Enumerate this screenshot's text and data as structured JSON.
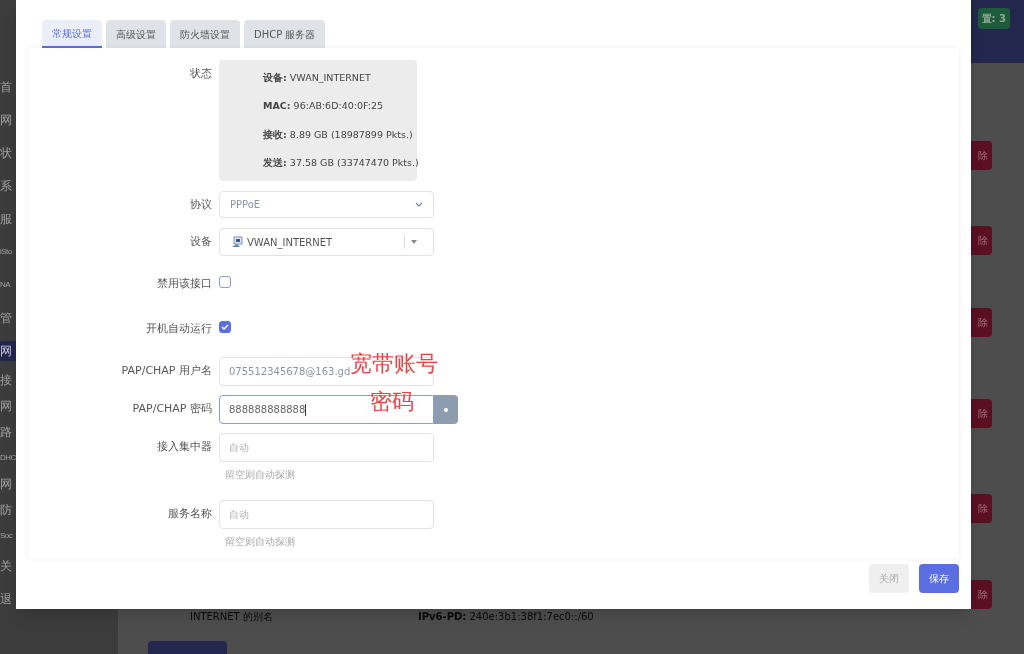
{
  "background": {
    "sidebar": [
      {
        "label": "首",
        "kind": "main",
        "selected": false
      },
      {
        "label": "网",
        "kind": "main",
        "selected": false
      },
      {
        "label": "状",
        "kind": "main",
        "selected": false
      },
      {
        "label": "系",
        "kind": "main",
        "selected": false
      },
      {
        "label": "服",
        "kind": "main",
        "selected": false
      },
      {
        "label": "iSto",
        "kind": "main",
        "selected": false
      },
      {
        "label": "NA",
        "kind": "main",
        "selected": false
      },
      {
        "label": "管",
        "kind": "main",
        "selected": false
      },
      {
        "label": "网",
        "kind": "main",
        "selected": true
      },
      {
        "label": "接",
        "kind": "sub",
        "selected": false
      },
      {
        "label": "网",
        "kind": "sub",
        "selected": false
      },
      {
        "label": "路",
        "kind": "sub",
        "selected": false
      },
      {
        "label": "DHC",
        "kind": "sub",
        "selected": false
      },
      {
        "label": "网",
        "kind": "sub",
        "selected": false
      },
      {
        "label": "防",
        "kind": "sub",
        "selected": false
      },
      {
        "label": "Soc",
        "kind": "sub",
        "selected": false
      },
      {
        "label": "关",
        "kind": "main",
        "selected": false
      },
      {
        "label": "退",
        "kind": "main",
        "selected": false
      }
    ],
    "badge": "置: 3",
    "delete_buttons": [
      "除",
      "除",
      "除",
      "除",
      "除",
      "除"
    ],
    "alias": "INTERNET 的别名",
    "ipv6": "**IPv6-PD:** 240e:3b1:38f1:7ec0::/60"
  },
  "dialog": {
    "tabs": [
      {
        "label": "常规设置",
        "selected": true
      },
      {
        "label": "高级设置",
        "selected": false
      },
      {
        "label": "防火墙设置",
        "selected": false
      },
      {
        "label": "DHCP 服务器",
        "selected": false
      }
    ],
    "status": {
      "label": "状态",
      "lines": [
        "**设备:** VWAN_INTERNET",
        "**MAC:** 96:AB:6D:40:0F:25",
        "**接收:** 8.89 GB (18987899 Pkts.)",
        "**发送:** 37.58 GB (33747470 Pkts.)"
      ]
    },
    "fields": [
      {
        "kind": "select",
        "label": "协议",
        "value": "PPPoE"
      },
      {
        "kind": "device",
        "label": "设备",
        "value": "VWAN_INTERNET"
      },
      {
        "kind": "checkbox",
        "label": "禁用该接口",
        "checked": false
      },
      {
        "kind": "checkbox",
        "label": "开机自动运行",
        "checked": true
      },
      {
        "kind": "text",
        "label": "PAP/CHAP 用户名",
        "value": "075512345678@163.gd",
        "note": "宽带账号"
      },
      {
        "kind": "password",
        "label": "PAP/CHAP 密码",
        "value": "888888888888",
        "note": "密码"
      },
      {
        "kind": "text",
        "label": "接入集中器",
        "placeholder": "自动",
        "hint": "留空则自动探测"
      },
      {
        "kind": "text",
        "label": "服务名称",
        "placeholder": "自动",
        "hint": "留空则自动探测"
      }
    ],
    "buttons": [
      {
        "label": "关闭",
        "kind": "secondary"
      },
      {
        "label": "保存",
        "kind": "primary"
      }
    ]
  }
}
